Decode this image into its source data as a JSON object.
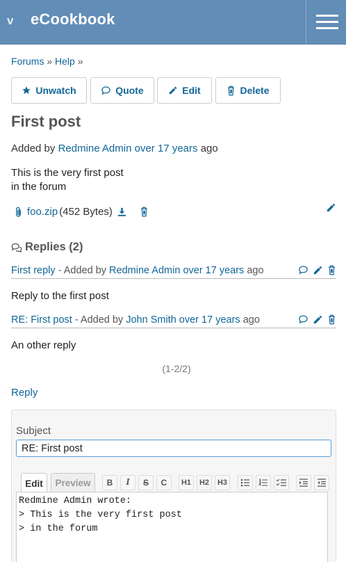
{
  "header": {
    "toggle": "v",
    "brand": "eCookbook"
  },
  "breadcrumb": {
    "items": [
      "Forums",
      "Help"
    ],
    "separator": "»"
  },
  "actions": {
    "unwatch": "Unwatch",
    "quote": "Quote",
    "edit": "Edit",
    "delete": "Delete"
  },
  "message": {
    "title": "First post",
    "added_by_prefix": "Added by",
    "author": "Redmine Admin",
    "time": "over 17 years",
    "time_suffix": "ago",
    "body_line1": "This is the very first post",
    "body_line2": "in the forum",
    "attachment": {
      "filename": "foo.zip",
      "size": "(452 Bytes)"
    }
  },
  "replies": {
    "heading": "Replies (2)",
    "items": [
      {
        "subject": "First reply",
        "added_by": "- Added by",
        "author": "Redmine Admin",
        "time": "over 17 years",
        "ago": "ago",
        "body": "Reply to the first post"
      },
      {
        "subject": "RE: First post",
        "added_by": "- Added by",
        "author": "John Smith",
        "time": "over 17 years",
        "ago": "ago",
        "body": "An other reply"
      }
    ],
    "pagination": "(1-2/2)"
  },
  "reply_link": "Reply",
  "form": {
    "subject_label": "Subject",
    "subject_value": "RE: First post",
    "tabs": [
      "Edit",
      "Preview"
    ],
    "toolbar": {
      "bold": "B",
      "italic": "I",
      "strike": "S",
      "code": "C",
      "h1": "H1",
      "h2": "H2",
      "h3": "H3"
    },
    "editor_text": "Redmine Admin wrote:\n> This is the very first post\n> in the forum"
  },
  "colors": {
    "header_bg": "#628db6",
    "link": "#116699"
  }
}
